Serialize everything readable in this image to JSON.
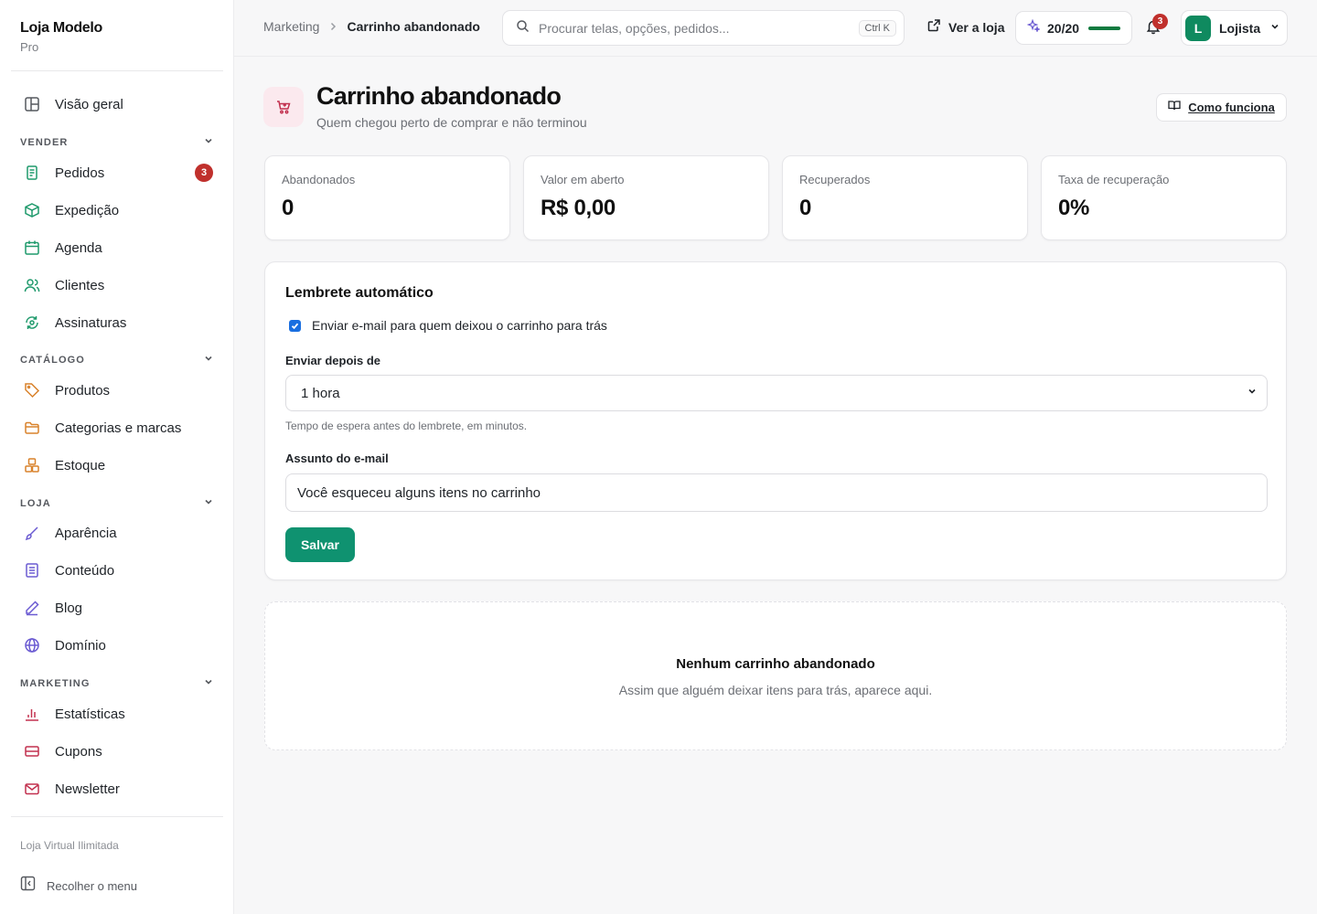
{
  "brand": {
    "name": "Loja Modelo",
    "plan": "Pro"
  },
  "sidebar": {
    "overview": {
      "label": "Visão geral",
      "icon": "layout-icon"
    },
    "sections": [
      {
        "title": "VENDER",
        "items": [
          {
            "label": "Pedidos",
            "icon": "receipt-icon",
            "badge": "3"
          },
          {
            "label": "Expedição",
            "icon": "box-icon"
          },
          {
            "label": "Agenda",
            "icon": "calendar-icon"
          },
          {
            "label": "Clientes",
            "icon": "users-icon"
          },
          {
            "label": "Assinaturas",
            "icon": "refresh-icon"
          }
        ]
      },
      {
        "title": "CATÁLOGO",
        "items": [
          {
            "label": "Produtos",
            "icon": "tag-icon"
          },
          {
            "label": "Categorias e marcas",
            "icon": "folder-icon"
          },
          {
            "label": "Estoque",
            "icon": "boxes-icon"
          }
        ]
      },
      {
        "title": "LOJA",
        "items": [
          {
            "label": "Aparência",
            "icon": "brush-icon"
          },
          {
            "label": "Conteúdo",
            "icon": "document-icon"
          },
          {
            "label": "Blog",
            "icon": "pen-icon"
          },
          {
            "label": "Domínio",
            "icon": "globe-icon"
          }
        ]
      },
      {
        "title": "MARKETING",
        "items": [
          {
            "label": "Estatísticas",
            "icon": "bar-chart-icon"
          },
          {
            "label": "Cupons",
            "icon": "ticket-icon"
          },
          {
            "label": "Newsletter",
            "icon": "mail-icon"
          }
        ]
      }
    ],
    "footer_note": "Loja Virtual Ilimitada",
    "collapse_label": "Recolher o menu"
  },
  "topbar": {
    "breadcrumb": [
      "Marketing",
      "Carrinho abandonado"
    ],
    "search_placeholder": "Procurar telas, opções, pedidos...",
    "search_shortcut": "Ctrl K",
    "view_store": "Ver a loja",
    "quota": {
      "label": "20/20",
      "fraction": 1.0
    },
    "notifications": "3",
    "user": {
      "initial": "L",
      "name": "Lojista"
    }
  },
  "page": {
    "title": "Carrinho abandonado",
    "subtitle": "Quem chegou perto de comprar e não terminou",
    "help_button": "Como funciona"
  },
  "stats": [
    {
      "label": "Abandonados",
      "value": "0"
    },
    {
      "label": "Valor em aberto",
      "value": "R$ 0,00"
    },
    {
      "label": "Recuperados",
      "value": "0"
    },
    {
      "label": "Taxa de recuperação",
      "value": "0%"
    }
  ],
  "reminder": {
    "title": "Lembrete automático",
    "checkbox_label": "Enviar e-mail para quem deixou o carrinho para trás",
    "checked": true,
    "delay_label": "Enviar depois de",
    "delay_value": "1 hora",
    "delay_hint": "Tempo de espera antes do lembrete, em minutos.",
    "subject_label": "Assunto do e-mail",
    "subject_value": "Você esqueceu alguns itens no carrinho",
    "save_label": "Salvar"
  },
  "empty": {
    "title": "Nenhum carrinho abandonado",
    "subtitle": "Assim que alguém deixar itens para trás, aparece aqui."
  },
  "colors": {
    "accent": "#0f9270",
    "badge": "#c0302c",
    "quota_bar": "#117a3f"
  }
}
